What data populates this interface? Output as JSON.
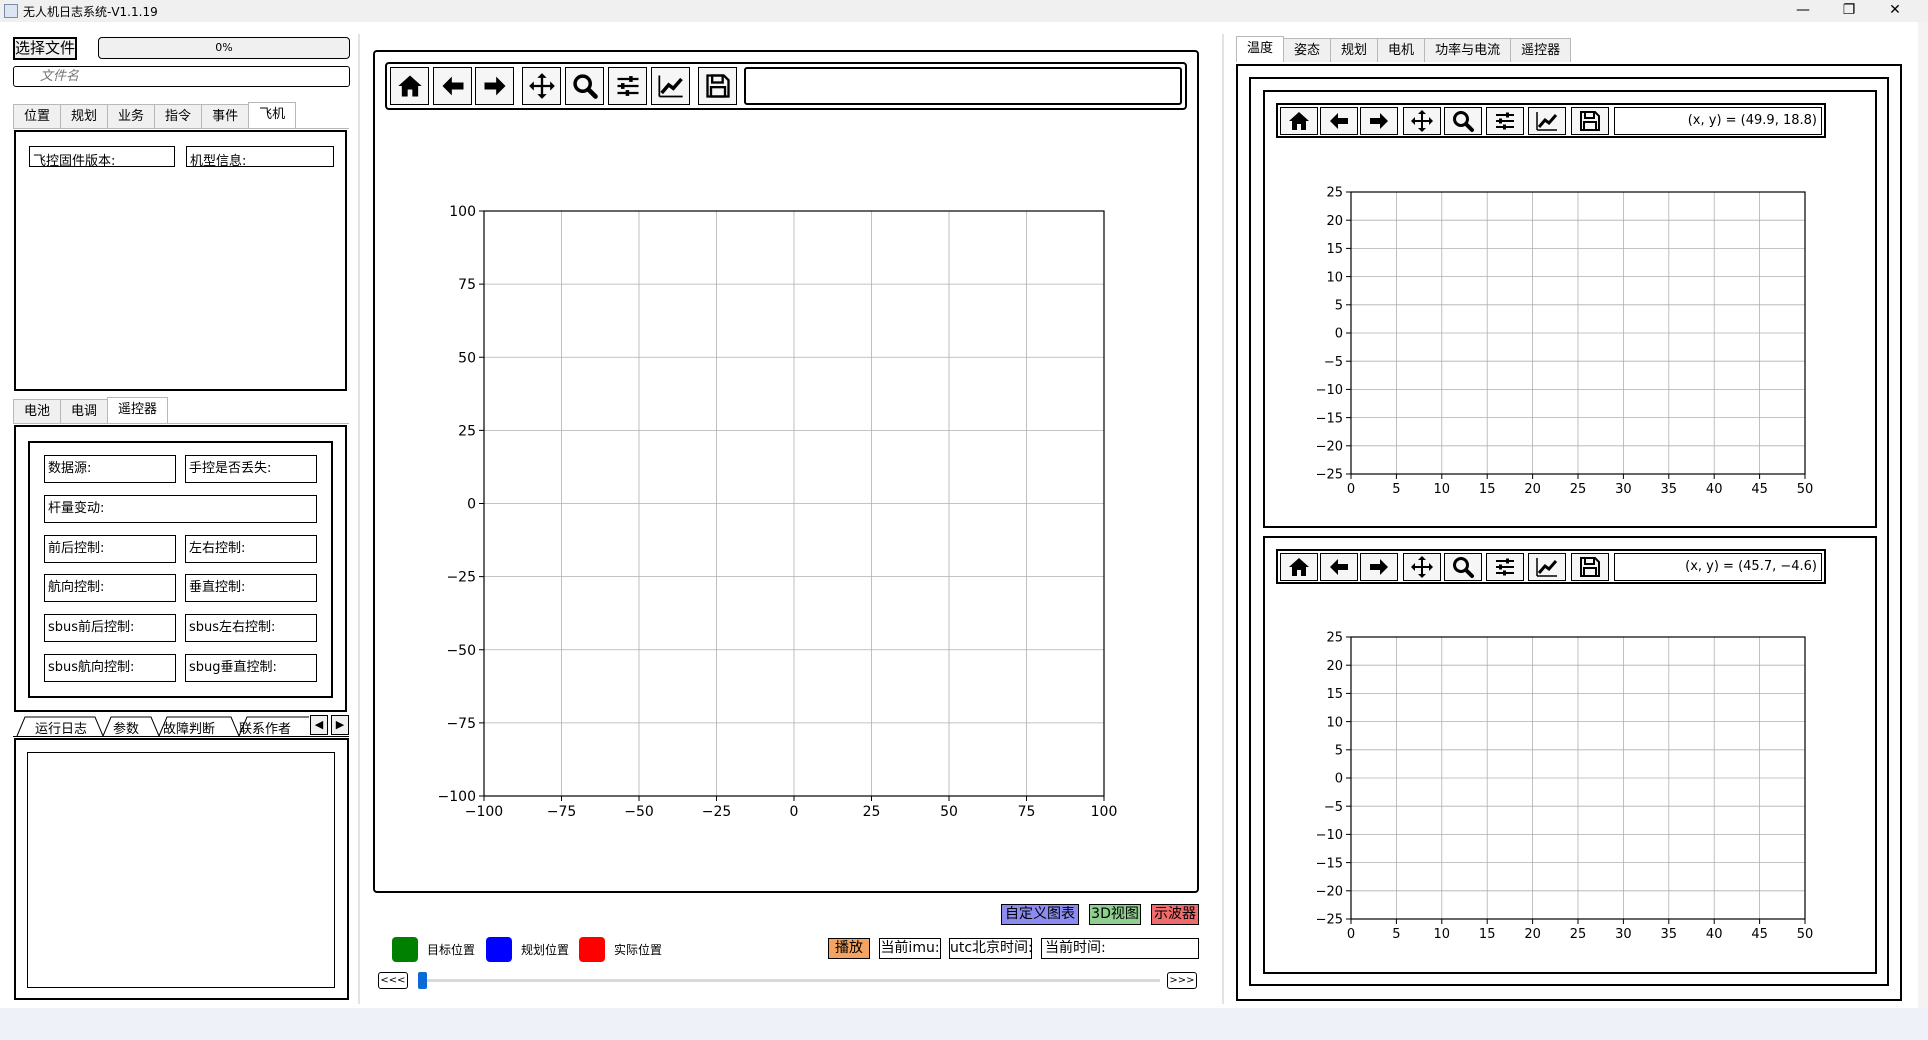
{
  "window": {
    "title": "无人机日志系统-V1.1.19",
    "controls": [
      "—",
      "❐",
      "✕"
    ]
  },
  "file": {
    "select_button": "选择文件",
    "progress_text": "0%",
    "progress_value": 0,
    "file_name_placeholder": "文件名"
  },
  "top_tabs": {
    "items": [
      "位置",
      "规划",
      "业务",
      "指令",
      "事件",
      "飞机"
    ],
    "active": "飞机"
  },
  "aircraft": {
    "firmware_label": "飞控固件版本:",
    "model_label": "机型信息:"
  },
  "mid_tabs": {
    "items": [
      "电池",
      "电调",
      "遥控器"
    ],
    "active": "遥控器"
  },
  "remote": {
    "data_source": "数据源:",
    "controller_lost": "手控是否丢失:",
    "stick_change": "杆量变动:",
    "pitch_ctrl": "前后控制:",
    "roll_ctrl": "左右控制:",
    "yaw_ctrl": "航向控制:",
    "vertical_ctrl": "垂直控制:",
    "sbus_pitch": "sbus前后控制:",
    "sbus_roll": "sbus左右控制:",
    "sbus_yaw": "sbus航向控制:",
    "sbus_vertical": "sbug垂直控制:"
  },
  "bottom_tabs": {
    "items": [
      "运行日志",
      "参数",
      "故障判断",
      "联系作者"
    ],
    "scroll_left": "◀",
    "scroll_right": "▶"
  },
  "toolbar_icons": [
    "home-icon",
    "back-arrow-icon",
    "forward-arrow-icon",
    "pan-icon",
    "zoom-icon",
    "configure-subplots-icon",
    "edit-axis-icon",
    "save-icon"
  ],
  "center_buttons": {
    "custom_chart": "自定义图表",
    "view_3d": "3D视图",
    "oscilloscope": "示波器",
    "play": "播放",
    "current_imu": "当前imu:",
    "utc_beijing": "utc北京时间:",
    "current_time": "当前时间:",
    "rewind": "<<<",
    "fast_forward": ">>>"
  },
  "legend": {
    "target": {
      "label": "目标位置",
      "color": "#008000"
    },
    "planned": {
      "label": "规划位置",
      "color": "#0000ff"
    },
    "actual": {
      "label": "实际位置",
      "color": "#ff0000"
    }
  },
  "colors": {
    "custom_chart_bg": "#8c8cf0",
    "view_3d_bg": "#8fcf8f",
    "oscilloscope_bg": "#f06c6c",
    "play_bg": "#f4a460",
    "slider_handle": "#0b6ad8"
  },
  "slider": {
    "value": 0
  },
  "right_tabs": {
    "items": [
      "温度",
      "姿态",
      "规划",
      "电机",
      "功率与电流",
      "遥控器"
    ],
    "active": "温度"
  },
  "plot1": {
    "coord_readout": "(x, y) = (49.9, 18.8)"
  },
  "plot2": {
    "coord_readout": "(x, y) = (45.7, −4.6)"
  },
  "chart_data": [
    {
      "type": "scatter",
      "name_hint": "center-position-plot",
      "title": "",
      "xlabel": "",
      "ylabel": "",
      "xlim": [
        -100,
        100
      ],
      "ylim": [
        -100,
        100
      ],
      "xticks": [
        "−100",
        "−75",
        "−50",
        "−25",
        "0",
        "25",
        "50",
        "75",
        "100"
      ],
      "yticks": [
        "100",
        "75",
        "50",
        "25",
        "0",
        "−25",
        "−50",
        "−75",
        "−100"
      ],
      "grid": true,
      "series": []
    },
    {
      "type": "line",
      "name_hint": "right-plot-1",
      "title": "",
      "xlabel": "",
      "ylabel": "",
      "xlim": [
        0,
        50
      ],
      "ylim": [
        -25,
        25
      ],
      "xticks": [
        "0",
        "5",
        "10",
        "15",
        "20",
        "25",
        "30",
        "35",
        "40",
        "45",
        "50"
      ],
      "yticks": [
        "25",
        "20",
        "15",
        "10",
        "5",
        "0",
        "−5",
        "−10",
        "−15",
        "−20",
        "−25"
      ],
      "grid": true,
      "series": []
    },
    {
      "type": "line",
      "name_hint": "right-plot-2",
      "title": "",
      "xlabel": "",
      "ylabel": "",
      "xlim": [
        0,
        50
      ],
      "ylim": [
        -25,
        25
      ],
      "xticks": [
        "0",
        "5",
        "10",
        "15",
        "20",
        "25",
        "30",
        "35",
        "40",
        "45",
        "50"
      ],
      "yticks": [
        "25",
        "20",
        "15",
        "10",
        "5",
        "0",
        "−5",
        "−10",
        "−15",
        "−20",
        "−25"
      ],
      "grid": true,
      "series": []
    }
  ]
}
